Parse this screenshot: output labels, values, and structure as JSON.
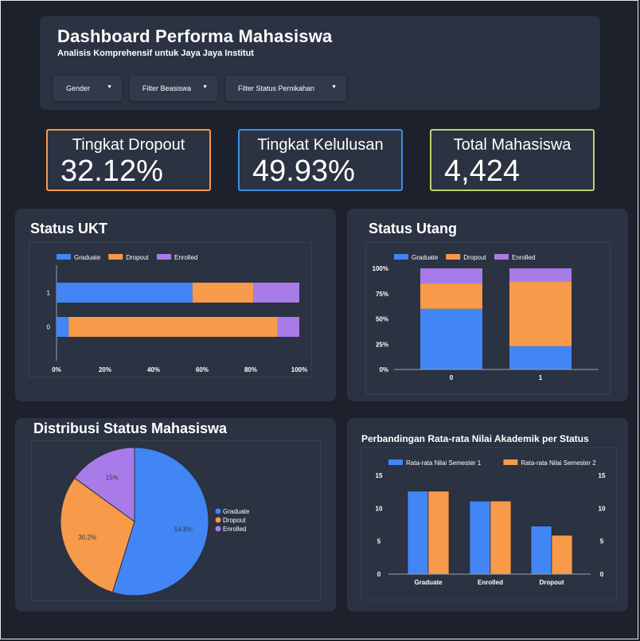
{
  "header": {
    "title": "Dashboard Performa Mahasiswa",
    "subtitle": "Analisis Komprehensif untuk Jaya Jaya Institut"
  },
  "filters": [
    {
      "label": "Gender"
    },
    {
      "label": "Filter Beasiswa"
    },
    {
      "label": "Filter Status Pernikahan"
    }
  ],
  "kpis": [
    {
      "label": "Tingkat Dropout",
      "value": "32.12%",
      "color": "#f79a4a"
    },
    {
      "label": "Tingkat Kelulusan",
      "value": "49.93%",
      "color": "#3b8fe8"
    },
    {
      "label": "Total Mahasiswa",
      "value": "4,424",
      "color": "#b9d66a"
    }
  ],
  "cards": {
    "ukt": "Status UKT",
    "utang": "Status Utang",
    "distribusi": "Distribusi Status Mahasiswa",
    "akademik": "Perbandingan Rata-rata Nilai Akademik per Status"
  },
  "colors": {
    "graduate": "#4285f4",
    "dropout": "#f79a4a",
    "enrolled": "#a87be8",
    "axis": "#9aa3b2"
  },
  "chart_data": [
    {
      "id": "ukt",
      "type": "bar",
      "orientation": "horizontal",
      "stacked": "percent",
      "categories": [
        "1",
        "0"
      ],
      "series": [
        {
          "name": "Graduate",
          "values": [
            56,
            5
          ]
        },
        {
          "name": "Dropout",
          "values": [
            25,
            86
          ]
        },
        {
          "name": "Enrolled",
          "values": [
            19,
            9
          ]
        }
      ],
      "x_ticks": [
        "0%",
        "20%",
        "40%",
        "60%",
        "80%",
        "100%"
      ],
      "xlim": [
        0,
        100
      ],
      "legend": "top-left"
    },
    {
      "id": "utang",
      "type": "bar",
      "orientation": "vertical",
      "stacked": "percent",
      "categories": [
        "0",
        "1"
      ],
      "series": [
        {
          "name": "Graduate",
          "values": [
            60,
            23
          ]
        },
        {
          "name": "Dropout",
          "values": [
            25,
            64
          ]
        },
        {
          "name": "Enrolled",
          "values": [
            15,
            13
          ]
        }
      ],
      "y_ticks": [
        "0%",
        "25%",
        "50%",
        "75%",
        "100%"
      ],
      "ylim": [
        0,
        100
      ],
      "legend": "top-left"
    },
    {
      "id": "distribusi",
      "type": "pie",
      "slices": [
        {
          "name": "Graduate",
          "value": 54.8,
          "label": "54.8%"
        },
        {
          "name": "Dropout",
          "value": 30.2,
          "label": "30.2%"
        },
        {
          "name": "Enrolled",
          "value": 15,
          "label": "15%"
        }
      ],
      "legend": "right"
    },
    {
      "id": "akademik",
      "type": "bar",
      "orientation": "vertical",
      "categories": [
        "Graduate",
        "Enrolled",
        "Dropout"
      ],
      "series": [
        {
          "name": "Rata-rata Nilai Semester 1",
          "values": [
            12.6,
            11.1,
            7.3
          ]
        },
        {
          "name": "Rata-rata Nilai Semester 2",
          "values": [
            12.6,
            11.1,
            5.9
          ]
        }
      ],
      "y_ticks": [
        "0",
        "5",
        "10",
        "15"
      ],
      "ylim": [
        0,
        15
      ],
      "legend": "top"
    }
  ]
}
